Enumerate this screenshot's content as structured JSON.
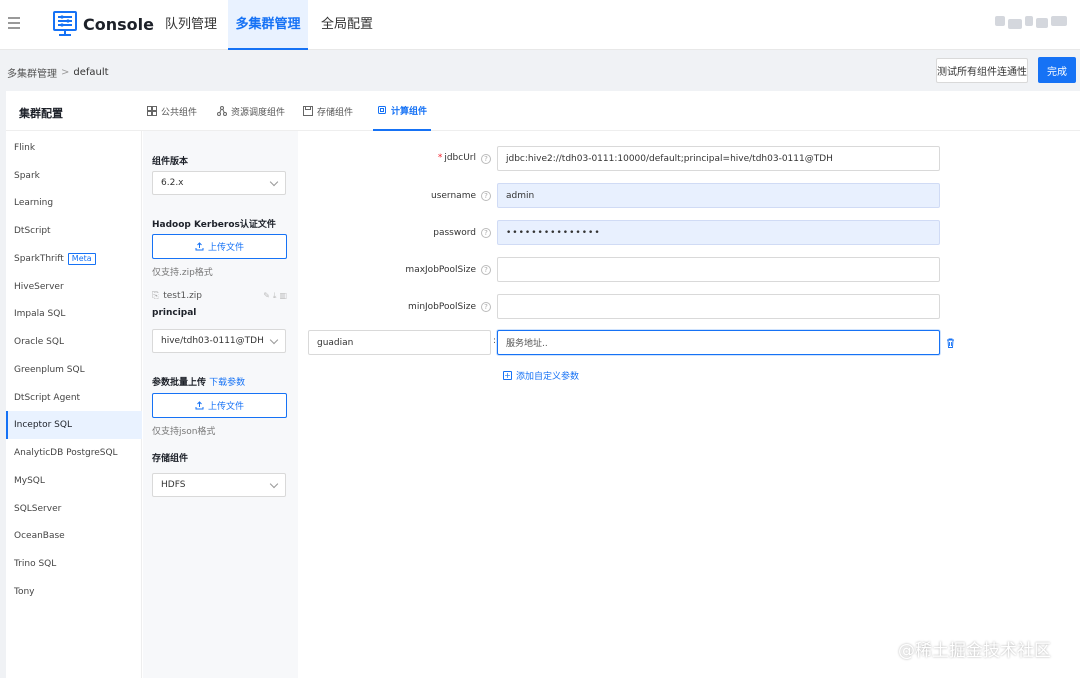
{
  "app": {
    "title": "Console"
  },
  "nav": {
    "tabs": [
      {
        "label": "队列管理",
        "active": false
      },
      {
        "label": "多集群管理",
        "active": true
      },
      {
        "label": "全局配置",
        "active": false
      }
    ]
  },
  "breadcrumb": {
    "root": "多集群管理",
    "separator": ">",
    "current": "default"
  },
  "toolbar": {
    "test_label": "测试所有组件连通性",
    "done_label": "完成"
  },
  "card": {
    "title": "集群配置",
    "tabs": [
      {
        "label": "公共组件",
        "icon": "grid-icon"
      },
      {
        "label": "资源调度组件",
        "icon": "share-icon"
      },
      {
        "label": "存储组件",
        "icon": "save-icon"
      },
      {
        "label": "计算组件",
        "icon": "cpu-icon",
        "active": true
      }
    ]
  },
  "sidebar": {
    "items": [
      {
        "label": "Flink"
      },
      {
        "label": "Spark"
      },
      {
        "label": "Learning"
      },
      {
        "label": "DtScript"
      },
      {
        "label": "SparkThrift",
        "badge": "Meta"
      },
      {
        "label": "HiveServer"
      },
      {
        "label": "Impala SQL"
      },
      {
        "label": "Oracle SQL"
      },
      {
        "label": "Greenplum SQL"
      },
      {
        "label": "DtScript Agent"
      },
      {
        "label": "Inceptor SQL",
        "active": true
      },
      {
        "label": "AnalyticDB PostgreSQL"
      },
      {
        "label": "MySQL"
      },
      {
        "label": "SQLServer"
      },
      {
        "label": "OceanBase"
      },
      {
        "label": "Trino SQL"
      },
      {
        "label": "Tony"
      }
    ]
  },
  "config": {
    "version_label": "组件版本",
    "version_value": "6.2.x",
    "kerberos_label": "Hadoop Kerberos认证文件",
    "upload_label": "上传文件",
    "zip_hint": "仅支持.zip格式",
    "file_name": "test1.zip",
    "principal_label": "principal",
    "principal_value": "hive/tdh03-0111@TDH",
    "batch_label": "参数批量上传",
    "download_label": "下载参数",
    "upload_label2": "上传文件",
    "json_hint": "仅支持json格式",
    "storage_label": "存储组件",
    "storage_value": "HDFS"
  },
  "form": {
    "fields": [
      {
        "label": "jdbcUrl",
        "required": true,
        "value": "jdbc:hive2://tdh03-0111:10000/default;principal=hive/tdh03-0111@TDH"
      },
      {
        "label": "username",
        "value": "admin"
      },
      {
        "label": "password",
        "value": "•••••••••••••••"
      },
      {
        "label": "maxJobPoolSize",
        "value": ""
      },
      {
        "label": "minJobPoolSize",
        "value": ""
      }
    ],
    "custom_key": "guadian",
    "custom_colon": ":",
    "custom_value_placeholder": "服务地址..",
    "add_param_label": "添加自定义参数"
  },
  "watermark": "@稀土掘金技术社区",
  "colors": {
    "accent": "#1672f5",
    "active_bg": "#e9f2ff"
  }
}
